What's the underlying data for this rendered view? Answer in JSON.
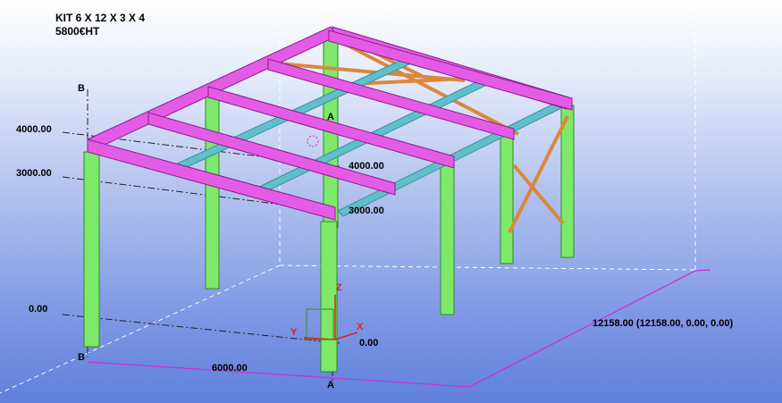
{
  "title": {
    "line1": "KIT 6 X 12 X 3 X 4",
    "line2": "5800€HT"
  },
  "grid_labels": {
    "b_top": "B",
    "b_bottom": "B",
    "a_top": "A",
    "a_bottom": "A"
  },
  "level_labels": {
    "left_4000": "4000.00",
    "left_3000": "3000.00",
    "left_0": "0.00",
    "center_4000": "4000.00",
    "center_3000": "3000.00",
    "center_0": "0.00"
  },
  "dimensions": {
    "width": "6000.00",
    "length_coord": "12158.00 (12158.00, 0.00, 0.00)"
  },
  "axes": {
    "x": "X",
    "y": "Y",
    "z": "Z"
  },
  "colors": {
    "column": "#7ee86a",
    "rafter": "#e45ce6",
    "purlin": "#5fc0cc",
    "bracing": "#d9883a",
    "axis": "#e02020"
  }
}
